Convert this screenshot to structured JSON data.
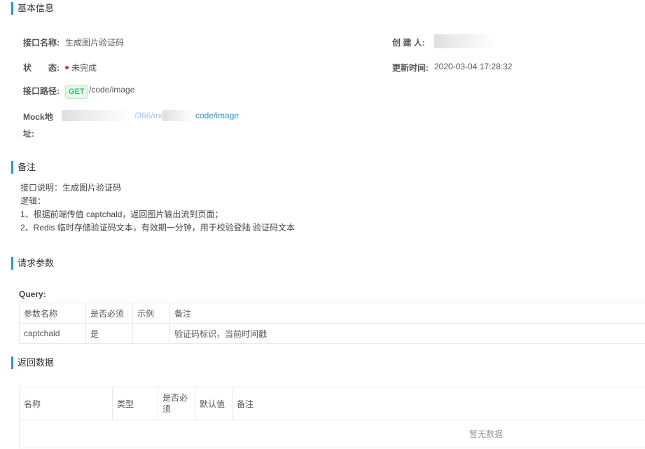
{
  "sections": {
    "basic": "基本信息",
    "remark": "备注",
    "request": "请求参数",
    "response": "返回数据"
  },
  "basic": {
    "name_label": "接口名称:",
    "name_value": "生成图片验证码",
    "creator_label": "创 建 人:",
    "status_label": "状　　态:",
    "status_value": "未完成",
    "updated_label": "更新时间:",
    "updated_value": "2020-03-04 17:28:32",
    "path_label": "接口路径:",
    "method": "GET",
    "path_value": "/code/image",
    "mock_label_1": "Mock地",
    "mock_label_2": "址:",
    "mock_mid": "/366/moc",
    "mock_tail": "code/image",
    "status_color": "#f5222d",
    "accent_color": "#2395f1"
  },
  "remark": {
    "lines": [
      "接口说明：生成图片验证码",
      "逻辑：",
      "1、根据前端传值 captchald，返回图片输出流到页面；",
      "2、Redis 临时存储验证码文本，有效期一分钟，用于校验登陆 验证码文本"
    ]
  },
  "request": {
    "query_label": "Query:",
    "headers": [
      "参数名称",
      "是否必须",
      "示例",
      "备注"
    ],
    "rows": [
      [
        "captchald",
        "是",
        "",
        "验证码标识，当前时间戳"
      ]
    ]
  },
  "response": {
    "headers": [
      "名称",
      "类型",
      "是否必须",
      "默认值",
      "备注"
    ],
    "empty_text": "暂无数据"
  }
}
